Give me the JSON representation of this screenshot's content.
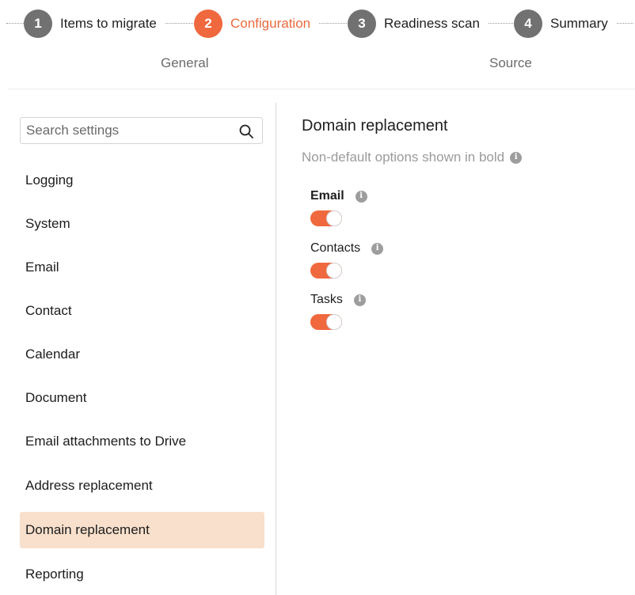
{
  "stepper": {
    "steps": [
      {
        "number": "1",
        "label": "Items to migrate",
        "active": false
      },
      {
        "number": "2",
        "label": "Configuration",
        "active": true
      },
      {
        "number": "3",
        "label": "Readiness scan",
        "active": false
      },
      {
        "number": "4",
        "label": "Summary",
        "active": false
      }
    ],
    "subtabs": [
      "General",
      "Source"
    ]
  },
  "sidebar": {
    "search_placeholder": "Search settings",
    "items": [
      {
        "label": "Logging"
      },
      {
        "label": "System"
      },
      {
        "label": "Email"
      },
      {
        "label": "Contact"
      },
      {
        "label": "Calendar"
      },
      {
        "label": "Document"
      },
      {
        "label": "Email attachments to Drive"
      },
      {
        "label": "Address replacement"
      },
      {
        "label": "Domain replacement",
        "selected": true
      },
      {
        "label": "Reporting"
      }
    ]
  },
  "main": {
    "title": "Domain replacement",
    "hint": "Non-default options shown in bold",
    "options": [
      {
        "label": "Email",
        "bold": true,
        "enabled": true
      },
      {
        "label": "Contacts",
        "bold": false,
        "enabled": true
      },
      {
        "label": "Tasks",
        "bold": false,
        "enabled": true
      }
    ]
  },
  "colors": {
    "accent": "#f0683e",
    "selected_bg": "#f8e0cc",
    "step_inactive": "#717171"
  }
}
